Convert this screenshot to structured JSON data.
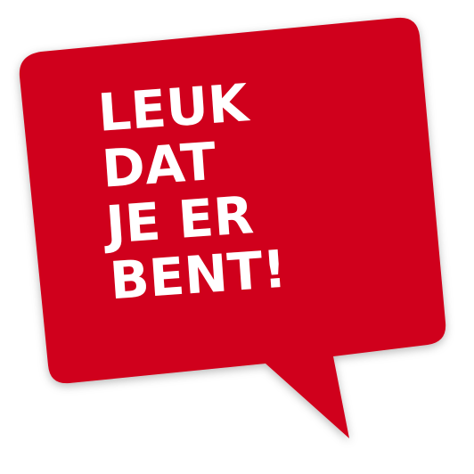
{
  "bubble": {
    "lines": [
      "LEUK",
      "DAT",
      "JE ER",
      "BENT!"
    ],
    "fill_color": "#d0021b",
    "text_color": "#ffffff"
  }
}
